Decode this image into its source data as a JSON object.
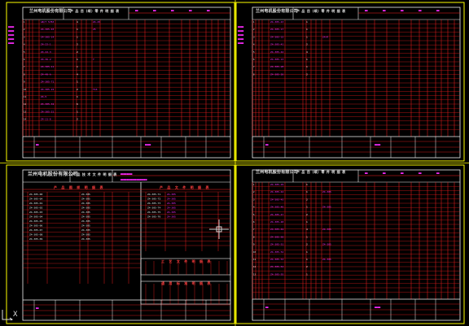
{
  "colors": {
    "background": "#000000",
    "sheet_border": "#ffff00",
    "grid_lines": "#ff1f1f",
    "frame_lines": "#f0f0f0",
    "data_text": "#ff2bff",
    "title_text": "#e6e6e6",
    "crosshair": "#cccccc"
  },
  "sheets": [
    {
      "company": "兰州电机股份有限公司",
      "doc_title": "产 品 目 (续) 零 件 明 细 表",
      "labels": [
        "图样代号",
        "序号",
        "代号",
        "名称",
        "数量",
        "材料"
      ],
      "rows": [
        {
          "code": "GB/T 5783",
          "name": "Z4-25",
          "qty": "4"
        },
        {
          "code": "Z4-305-03",
          "name": "25",
          "qty": "1"
        },
        {
          "code": "Z4-305-14",
          "name": "",
          "qty": "1"
        },
        {
          "code": "Z4-22-1",
          "name": "",
          "qty": "2"
        },
        {
          "code": "Z4-22-3",
          "name": "",
          "qty": "2"
        },
        {
          "code": "Z4-36-2",
          "name": "Y",
          "qty": "1"
        },
        {
          "code": "Z4-305-11",
          "name": "",
          "qty": "1"
        },
        {
          "code": "Z4-40-A",
          "name": "",
          "qty": "4"
        },
        {
          "code": "Z4-305-71",
          "name": "",
          "qty": "1"
        },
        {
          "code": "Z4-305-22",
          "name": "T16",
          "qty": "2"
        },
        {
          "code": "Z4-5",
          "name": "",
          "qty": "1"
        },
        {
          "code": "Z4-305-32",
          "name": "",
          "qty": "6"
        },
        {
          "code": "Z4-305-21",
          "name": "",
          "qty": "1"
        },
        {
          "code": "Z4-11-6",
          "name": "",
          "qty": "2"
        }
      ]
    },
    {
      "company": "兰州电机股份有限公司",
      "doc_title": "产 品 目 (续) 零 件 明 细 表",
      "labels": [
        "图样代号",
        "序号",
        "代号",
        "名称",
        "数量",
        "材料"
      ],
      "rows": [
        {
          "code": "Z4-305-43",
          "name": "",
          "qty": "1"
        },
        {
          "code": "Z4-305-17",
          "name": "",
          "qty": "1"
        },
        {
          "code": "Z4-305-15",
          "name": "Z4/R",
          "qty": "1"
        },
        {
          "code": "Z4-305-41",
          "name": "",
          "qty": "2"
        },
        {
          "code": "Z4-305-42",
          "name": "",
          "qty": "4"
        },
        {
          "code": "Z4-305-13",
          "name": "",
          "qty": "1"
        },
        {
          "code": "Z4-305-28",
          "name": "",
          "qty": "1"
        },
        {
          "code": "Z4-305-26",
          "name": "",
          "qty": "2"
        }
      ]
    },
    {
      "company": "兰州电机股份有限公司",
      "doc_title": "产 品 技 术 文 件 明 细 表",
      "sub_title_left": "产 品 图 样 明 细 表",
      "sub_title_right": "产 品 文 件 明 细 表",
      "lower_title_1": "工 艺 文 件 明 细 表",
      "lower_title_2": "通 用 标 准 明 细 表",
      "rows": [
        {
          "code": "Z4-305-00",
          "name": "",
          "qty": "Z4-305"
        },
        {
          "code": "Z4-305-0A",
          "name": "",
          "qty": "Z4-305"
        },
        {
          "code": "Z4-305-01",
          "name": "",
          "qty": "Z4-305"
        },
        {
          "code": "Z4-305-02",
          "name": "",
          "qty": "Z4-305"
        },
        {
          "code": "Z4-305-03",
          "name": "",
          "qty": "Z4-305"
        },
        {
          "code": "Z4-305-04",
          "name": "",
          "qty": "Z4-305"
        },
        {
          "code": "Z4-305-05",
          "name": "",
          "qty": "Z4-305"
        },
        {
          "code": "Z4-305-06",
          "name": "",
          "qty": "Z4-305"
        },
        {
          "code": "Z4-305-07",
          "name": "",
          "qty": "Z4-305"
        },
        {
          "code": "Z4-305-08",
          "name": "",
          "qty": "Z4-305"
        },
        {
          "code": "Z4-305-09",
          "name": "",
          "qty": "Z4-305"
        }
      ],
      "right_rows": [
        {
          "code": "Z4-305-T1",
          "name": "Z4-305"
        },
        {
          "code": "Z4-305-T2",
          "name": "Z4-305"
        },
        {
          "code": "Z4-305-T3",
          "name": "Z4-305"
        },
        {
          "code": "Z4-305-T4",
          "name": "Z4-305"
        },
        {
          "code": "Z4-305-T5",
          "name": "Z4-305"
        },
        {
          "code": "Z4-305-T6",
          "name": "Z4-305"
        }
      ]
    },
    {
      "company": "兰州电机股份有限公司",
      "doc_title": "产 品 目 (续) 零 件 明 细 表",
      "labels": [
        "图样代号",
        "序号",
        "代号",
        "名称",
        "数量",
        "材料"
      ],
      "rows": [
        {
          "code": "Z4-305-29",
          "name": "",
          "qty": "1"
        },
        {
          "code": "Z4-305-44",
          "name": "Z4-305",
          "qty": "1"
        },
        {
          "code": "Z4-305-45",
          "name": "",
          "qty": "2"
        },
        {
          "code": "Z4-305-46",
          "name": "Z4-305",
          "qty": "1"
        },
        {
          "code": "Z4-305-47",
          "name": "",
          "qty": "2"
        },
        {
          "code": "Z4-305-48",
          "name": "",
          "qty": "1"
        },
        {
          "code": "Z4-305-49",
          "name": "Z4-305",
          "qty": "4"
        },
        {
          "code": "Z4-305-50",
          "name": "",
          "qty": "1"
        },
        {
          "code": "Z4-305-51",
          "name": "Z4-305",
          "qty": "2"
        },
        {
          "code": "Z4-305-52",
          "name": "",
          "qty": "1"
        },
        {
          "code": "Z4-305-53",
          "name": "Z4-305",
          "qty": "1"
        },
        {
          "code": "Z4-305-54",
          "name": "",
          "qty": "2"
        },
        {
          "code": "Z4-305-55",
          "name": "",
          "qty": "1"
        }
      ]
    }
  ],
  "ucs_icon": "ucs-axis-icon",
  "crosshair_icon": "cursor-crosshair-icon"
}
